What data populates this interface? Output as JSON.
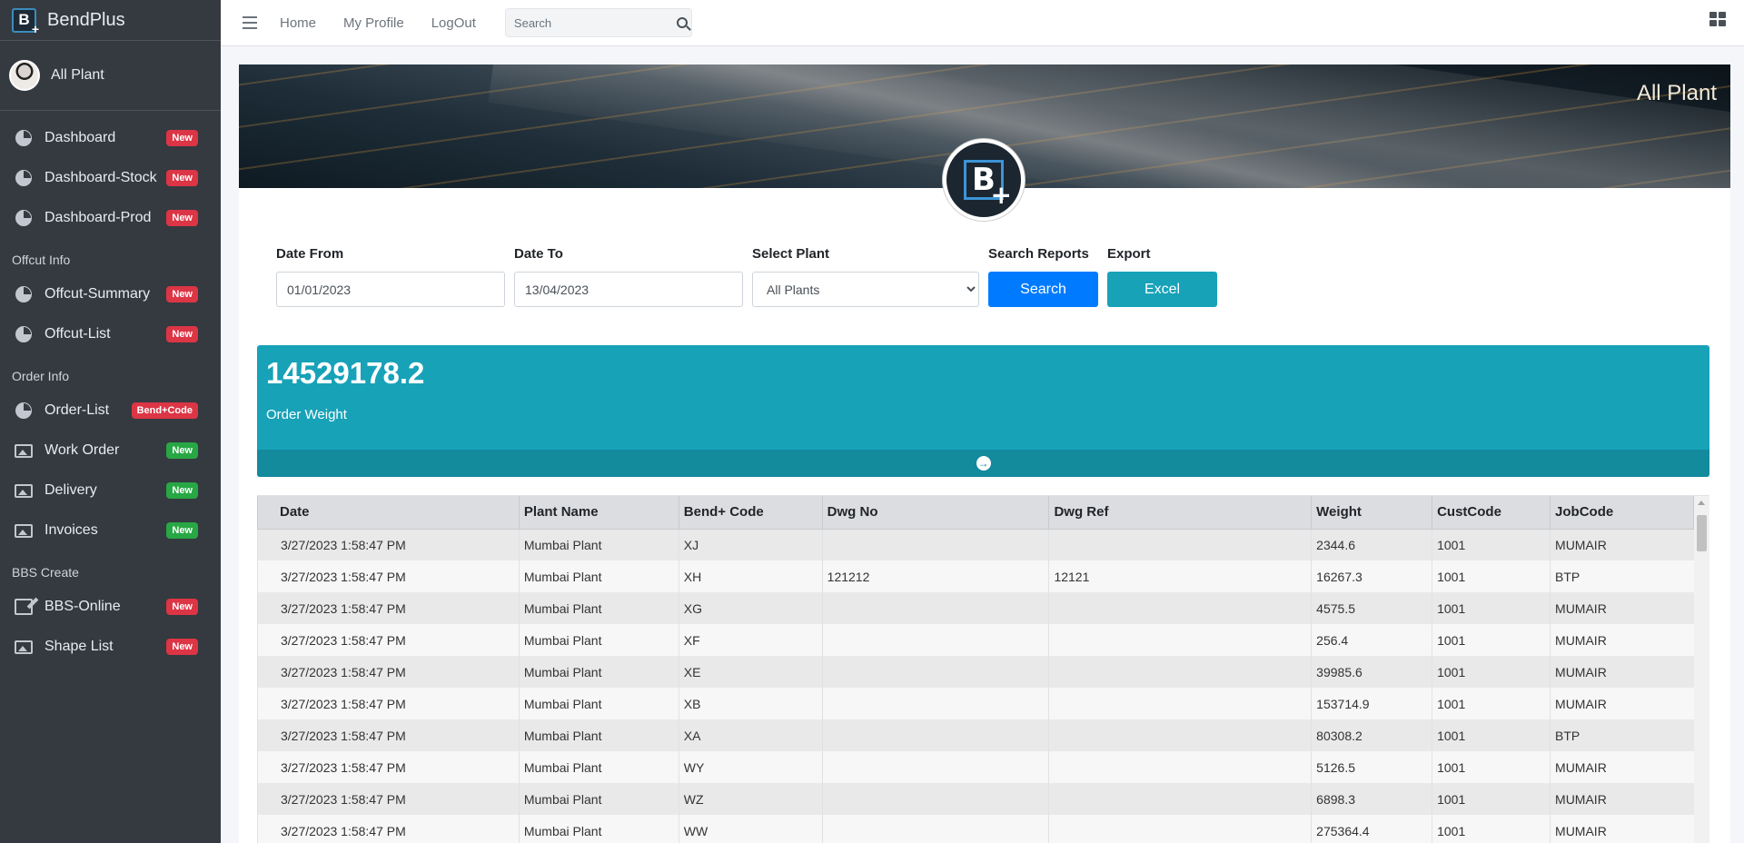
{
  "brand": {
    "name": "BendPlus",
    "logo_letter": "B",
    "logo_plus": "+"
  },
  "user": {
    "name": "All Plant"
  },
  "sidebar": {
    "groups": [
      {
        "header": "",
        "items": [
          {
            "label": "Dashboard",
            "icon": "pie-chart-icon",
            "badge": "New",
            "badge_color": "#dc3545"
          },
          {
            "label": "Dashboard-Stock",
            "icon": "pie-chart-icon",
            "badge": "New",
            "badge_color": "#dc3545"
          },
          {
            "label": "Dashboard-Prod",
            "icon": "pie-chart-icon",
            "badge": "New",
            "badge_color": "#dc3545"
          }
        ]
      },
      {
        "header": "Offcut Info",
        "items": [
          {
            "label": "Offcut-Summary",
            "icon": "pie-chart-icon",
            "badge": "New",
            "badge_color": "#dc3545"
          },
          {
            "label": "Offcut-List",
            "icon": "pie-chart-icon",
            "badge": "New",
            "badge_color": "#dc3545"
          }
        ]
      },
      {
        "header": "Order Info",
        "items": [
          {
            "label": "Order-List",
            "icon": "pie-chart-icon",
            "badge": "Bend+Code",
            "badge_color": "#dc3545"
          },
          {
            "label": "Work Order",
            "icon": "image-icon",
            "badge": "New",
            "badge_color": "#28a745"
          },
          {
            "label": "Delivery",
            "icon": "image-icon",
            "badge": "New",
            "badge_color": "#28a745"
          },
          {
            "label": "Invoices",
            "icon": "image-icon",
            "badge": "New",
            "badge_color": "#28a745"
          }
        ]
      },
      {
        "header": "BBS Create",
        "items": [
          {
            "label": "BBS-Online",
            "icon": "edit-icon",
            "badge": "New",
            "badge_color": "#dc3545"
          },
          {
            "label": "Shape List",
            "icon": "image-icon",
            "badge": "New",
            "badge_color": "#dc3545"
          }
        ]
      }
    ]
  },
  "topbar": {
    "links": [
      "Home",
      "My Profile",
      "LogOut"
    ],
    "search_placeholder": "Search"
  },
  "hero": {
    "title": "All Plant"
  },
  "filters": {
    "date_from_label": "Date From",
    "date_from_value": "01/01/2023",
    "date_to_label": "Date To",
    "date_to_value": "13/04/2023",
    "plant_label": "Select Plant",
    "plant_value": "All Plants",
    "search_label": "Search Reports",
    "search_button": "Search",
    "export_label": "Export",
    "export_button": "Excel"
  },
  "summary": {
    "value": "14529178.2",
    "label": "Order Weight"
  },
  "colors": {
    "sidebar": "#343a40",
    "info": "#17a2b8",
    "primary": "#007bff",
    "danger": "#dc3545",
    "success": "#28a745"
  },
  "table": {
    "columns": [
      "Date",
      "Plant Name",
      "Bend+ Code",
      "Dwg No",
      "Dwg Ref",
      "Weight",
      "CustCode",
      "JobCode"
    ],
    "rows": [
      [
        "3/27/2023 1:58:47 PM",
        "Mumbai Plant",
        "XJ",
        "",
        "",
        "2344.6",
        "1001",
        "MUMAIR"
      ],
      [
        "3/27/2023 1:58:47 PM",
        "Mumbai Plant",
        "XH",
        "121212",
        "12121",
        "16267.3",
        "1001",
        "BTP"
      ],
      [
        "3/27/2023 1:58:47 PM",
        "Mumbai Plant",
        "XG",
        "",
        "",
        "4575.5",
        "1001",
        "MUMAIR"
      ],
      [
        "3/27/2023 1:58:47 PM",
        "Mumbai Plant",
        "XF",
        "",
        "",
        "256.4",
        "1001",
        "MUMAIR"
      ],
      [
        "3/27/2023 1:58:47 PM",
        "Mumbai Plant",
        "XE",
        "",
        "",
        "39985.6",
        "1001",
        "MUMAIR"
      ],
      [
        "3/27/2023 1:58:47 PM",
        "Mumbai Plant",
        "XB",
        "",
        "",
        "153714.9",
        "1001",
        "MUMAIR"
      ],
      [
        "3/27/2023 1:58:47 PM",
        "Mumbai Plant",
        "XA",
        "",
        "",
        "80308.2",
        "1001",
        "BTP"
      ],
      [
        "3/27/2023 1:58:47 PM",
        "Mumbai Plant",
        "WY",
        "",
        "",
        "5126.5",
        "1001",
        "MUMAIR"
      ],
      [
        "3/27/2023 1:58:47 PM",
        "Mumbai Plant",
        "WZ",
        "",
        "",
        "6898.3",
        "1001",
        "MUMAIR"
      ],
      [
        "3/27/2023 1:58:47 PM",
        "Mumbai Plant",
        "WW",
        "",
        "",
        "275364.4",
        "1001",
        "MUMAIR"
      ]
    ]
  }
}
